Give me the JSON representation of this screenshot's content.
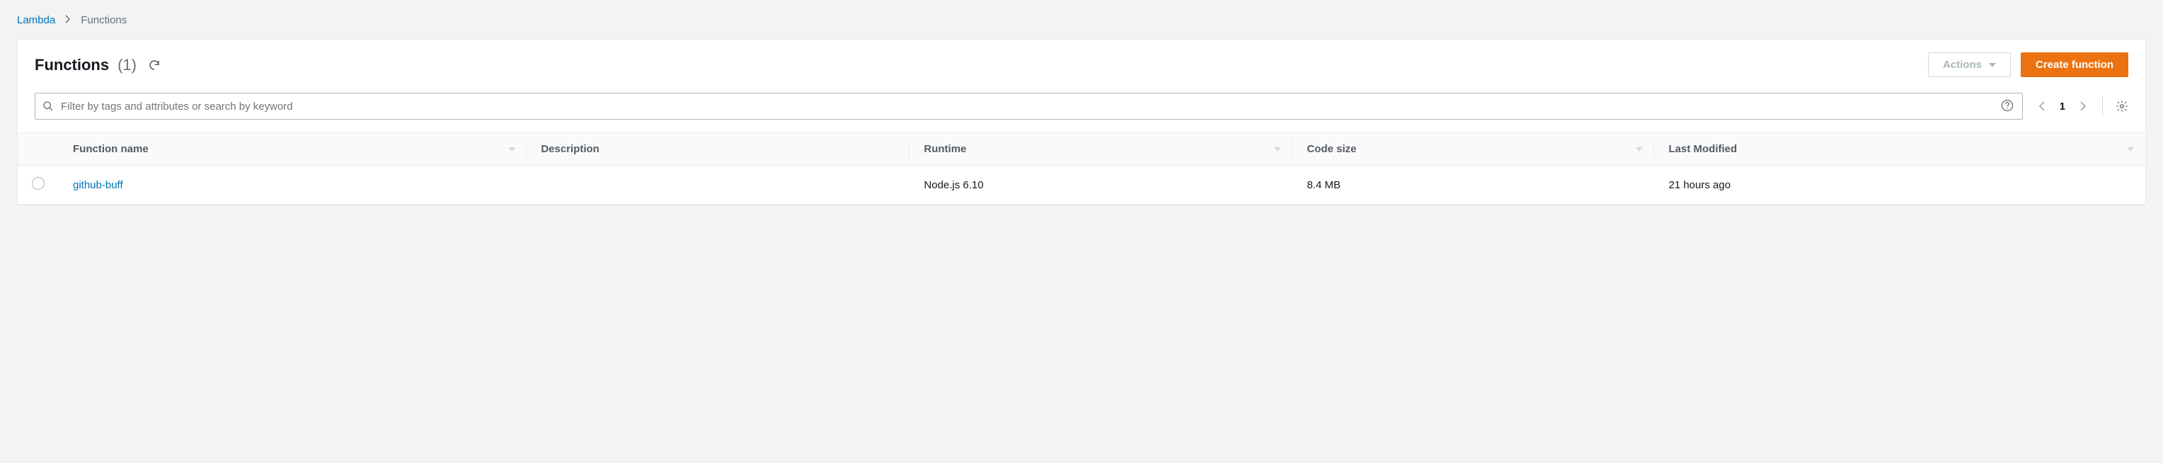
{
  "breadcrumb": {
    "root": "Lambda",
    "current": "Functions"
  },
  "header": {
    "title": "Functions",
    "count": "(1)",
    "actions_label": "Actions",
    "create_label": "Create function"
  },
  "search": {
    "placeholder": "Filter by tags and attributes or search by keyword"
  },
  "pagination": {
    "page": "1"
  },
  "table": {
    "columns": {
      "name": "Function name",
      "description": "Description",
      "runtime": "Runtime",
      "size": "Code size",
      "modified": "Last Modified"
    },
    "rows": [
      {
        "name": "github-buff",
        "description": "",
        "runtime": "Node.js 6.10",
        "size": "8.4 MB",
        "modified": "21 hours ago"
      }
    ]
  }
}
